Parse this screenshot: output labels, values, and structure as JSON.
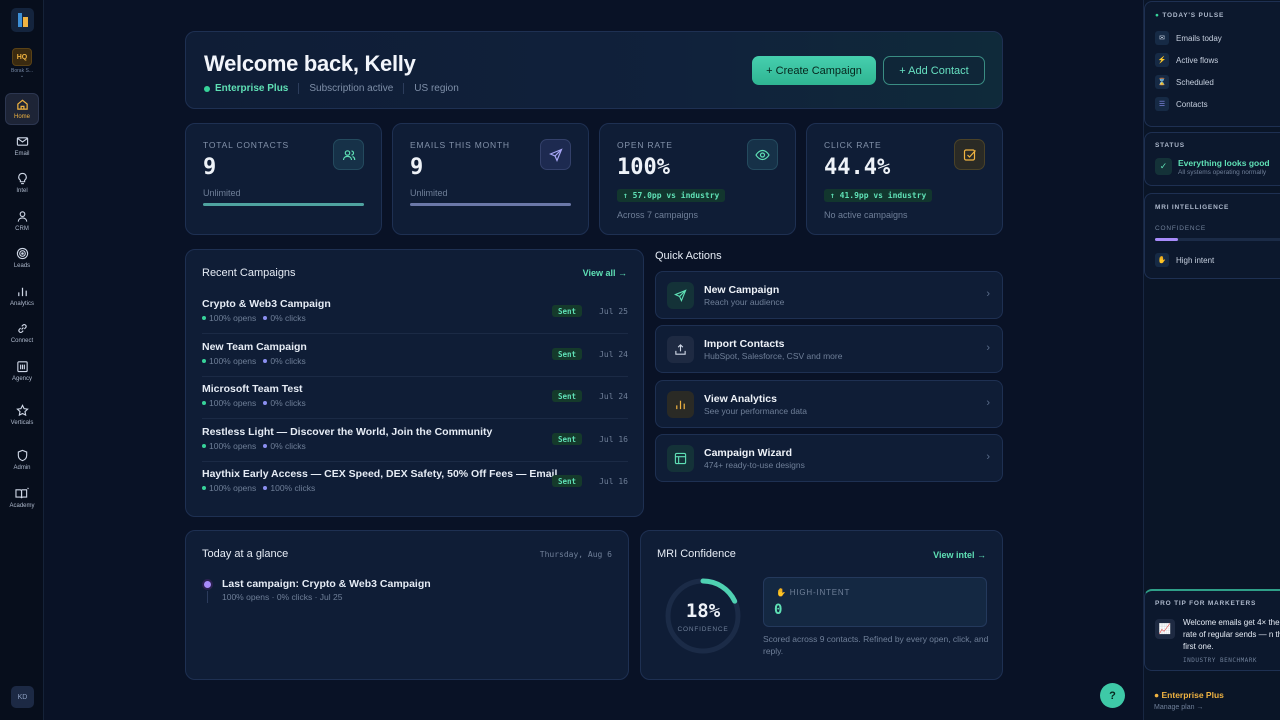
{
  "sidebar": {
    "org_badge": "HQ",
    "org_name": "Borak S...",
    "items": [
      {
        "label": "Home",
        "icon": "home-icon"
      },
      {
        "label": "Email",
        "icon": "mail-icon"
      },
      {
        "label": "Intel",
        "icon": "lightbulb-icon"
      },
      {
        "label": "CRM",
        "icon": "user-icon"
      },
      {
        "label": "Leads",
        "icon": "target-icon"
      },
      {
        "label": "Analytics",
        "icon": "bar-chart-icon"
      },
      {
        "label": "Connect",
        "icon": "link-icon"
      },
      {
        "label": "Agency",
        "icon": "building-icon"
      },
      {
        "label": "Verticals",
        "icon": "star-icon"
      },
      {
        "label": "Admin",
        "icon": "shield-icon"
      },
      {
        "label": "Academy",
        "icon": "book-icon"
      }
    ],
    "avatar": "KD"
  },
  "welcome": {
    "title": "Welcome back, Kelly",
    "plan": "Enterprise Plus",
    "subscription": "Subscription active",
    "region": "US region",
    "create_label": "+ Create Campaign",
    "add_label": "+ Add Contact"
  },
  "stats": [
    {
      "title": "TOTAL CONTACTS",
      "value": "9",
      "sub": "Unlimited",
      "icon": "users-icon",
      "bar_fill": 1.0
    },
    {
      "title": "EMAILS THIS MONTH",
      "value": "9",
      "sub": "Unlimited",
      "icon": "send-icon",
      "bar_fill": 1.0
    },
    {
      "title": "OPEN RATE",
      "value": "100%",
      "pill": "↑ 57.0pp vs industry",
      "sub": "Across 7 campaigns",
      "icon": "eye-icon"
    },
    {
      "title": "CLICK RATE",
      "value": "44.4%",
      "pill": "↑ 41.9pp vs industry",
      "sub": "No active campaigns",
      "icon": "check-square-icon"
    }
  ],
  "recent": {
    "title": "Recent Campaigns",
    "view_all": "View all →",
    "items": [
      {
        "name": "Crypto & Web3 Campaign",
        "opens": "100% opens",
        "clicks": "0% clicks",
        "status": "Sent",
        "date": "Jul 25"
      },
      {
        "name": "New Team Campaign",
        "opens": "100% opens",
        "clicks": "0% clicks",
        "status": "Sent",
        "date": "Jul 24"
      },
      {
        "name": "Microsoft Team Test",
        "opens": "100% opens",
        "clicks": "0% clicks",
        "status": "Sent",
        "date": "Jul 24"
      },
      {
        "name": "Restless Light — Discover the World, Join the Community",
        "opens": "100% opens",
        "clicks": "0% clicks",
        "status": "Sent",
        "date": "Jul 16"
      },
      {
        "name": "Haythix Early Access — CEX Speed, DEX Safety, 50% Off Fees — Email",
        "opens": "100% opens",
        "clicks": "100% clicks",
        "status": "Sent",
        "date": "Jul 16"
      }
    ]
  },
  "quick_actions": {
    "title": "Quick Actions",
    "items": [
      {
        "name": "New Campaign",
        "desc": "Reach your audience",
        "icon": "send-icon"
      },
      {
        "name": "Import Contacts",
        "desc": "HubSpot, Salesforce, CSV and more",
        "icon": "upload-icon"
      },
      {
        "name": "View Analytics",
        "desc": "See your performance data",
        "icon": "analytics-icon"
      },
      {
        "name": "Campaign Wizard",
        "desc": "474+ ready-to-use designs",
        "icon": "layout-icon"
      }
    ]
  },
  "glance": {
    "title": "Today at a glance",
    "date": "Thursday, Aug 6",
    "last_campaign": "Last campaign: Crypto & Web3 Campaign",
    "meta": "100% opens · 0% clicks · Jul 25"
  },
  "mri": {
    "title": "MRI Confidence",
    "view_intel": "View intel →",
    "percent": "18%",
    "confidence_value": 0.18,
    "confidence_label": "CONFIDENCE",
    "high_intent_label": "HIGH-INTENT",
    "high_intent_value": "0",
    "desc": "Scored across 9 contacts. Refined by every open, click, and reply."
  },
  "right_panel": {
    "pulse_title": "TODAY'S PULSE",
    "pulse_items": [
      "Emails today",
      "Active flows",
      "Scheduled",
      "Contacts"
    ],
    "status_title": "STATUS",
    "status_main": "Everything looks good",
    "status_sub": "All systems operating normally",
    "mri_title": "MRI INTELLIGENCE",
    "mri_conf": "CONFIDENCE",
    "mri_conf_value": 0.18,
    "mri_high": "High intent",
    "tip_title": "PRO TIP FOR MARKETERS",
    "tip_text": "Welcome emails get 4× the rate of regular sends — n the first one.",
    "tip_source": "INDUSTRY BENCHMARK",
    "plan": "Enterprise Plus",
    "manage": "Manage plan →"
  },
  "help": "?"
}
